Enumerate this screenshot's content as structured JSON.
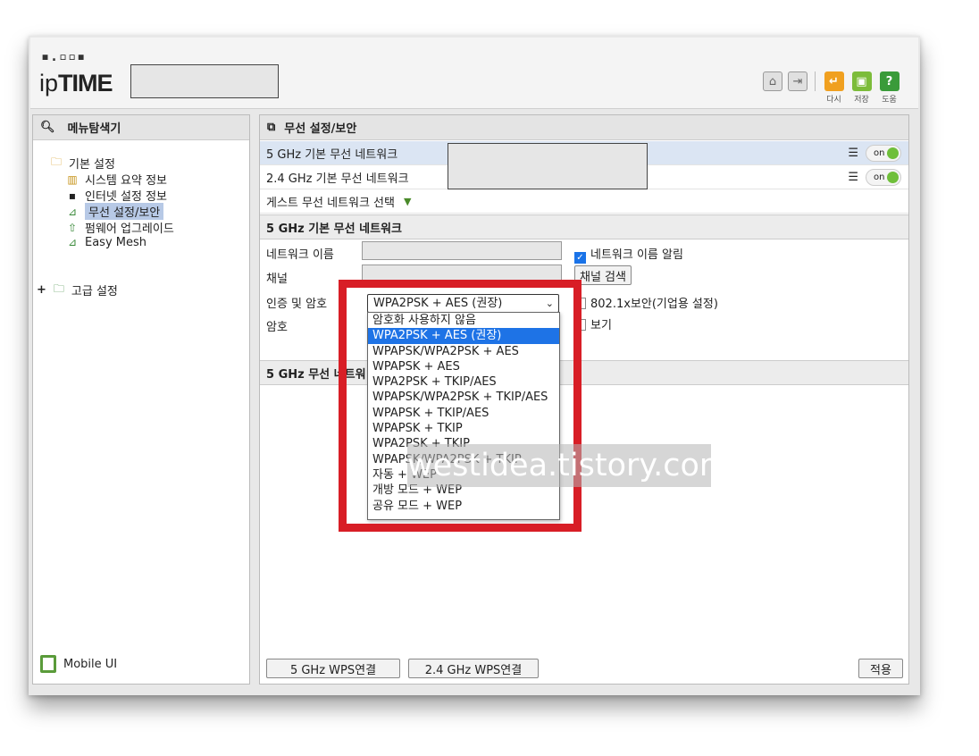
{
  "brand": {
    "logo_dots": "▪.▫▫▪",
    "logo_prefix": "ip",
    "logo_main": "TIME"
  },
  "header_buttons": [
    {
      "icon": "home-icon",
      "label": ""
    },
    {
      "icon": "logout-icon",
      "label": ""
    },
    {
      "icon": "refresh-icon",
      "label": "다시",
      "color": "#f0a020"
    },
    {
      "icon": "save-icon",
      "label": "저장",
      "color": "#7cbc3a"
    },
    {
      "icon": "help-icon",
      "label": "도움",
      "color": "#3a9b3a"
    }
  ],
  "sidebar": {
    "title": "메뉴탐색기",
    "basic": {
      "label": "기본 설정",
      "items": [
        {
          "label": "시스템 요약 정보",
          "icon": "chart-icon"
        },
        {
          "label": "인터넷 설정 정보",
          "icon": "computer-icon"
        },
        {
          "label": "무선 설정/보안",
          "icon": "wireless-icon",
          "selected": true
        },
        {
          "label": "펌웨어 업그레이드",
          "icon": "upgrade-icon"
        },
        {
          "label": "Easy Mesh",
          "icon": "mesh-icon"
        }
      ]
    },
    "advanced": {
      "expand": "+",
      "label": "고급 설정"
    },
    "mobile_label": "Mobile UI"
  },
  "main": {
    "title": "무선 설정/보안",
    "networks": [
      {
        "label": "5 GHz 기본 무선 네트워크",
        "switch": "on"
      },
      {
        "label": "2.4 GHz 기본 무선 네트워크",
        "switch": "on"
      }
    ],
    "guest_label": "게스트 무선 네트워크 선택",
    "section_title": "5 GHz 기본 무선 네트워크",
    "form": {
      "network_name_label": "네트워크 이름",
      "broadcast_label": "네트워크 이름 알림",
      "channel_label": "채널",
      "channel_search_button": "채널 검색",
      "auth_label": "인증 및 암호",
      "auth_selected": "WPA2PSK + AES (권장)",
      "enterprise_label": "802.1x보안(기업용 설정)",
      "password_label": "암호",
      "show_label": "보기"
    },
    "section2_title": "5 GHz 무선 네트워",
    "dropdown_options": [
      "암호화 사용하지 않음",
      "WPA2PSK + AES (권장)",
      "WPAPSK/WPA2PSK + AES",
      "WPAPSK + AES",
      "WPA2PSK + TKIP/AES",
      "WPAPSK/WPA2PSK + TKIP/AES",
      "WPAPSK + TKIP/AES",
      "WPAPSK + TKIP",
      "WPA2PSK + TKIP",
      "WPAPSK/WPA2PSK + TKIP",
      "자동 + WEP",
      "개방 모드 + WEP",
      "공유 모드 + WEP"
    ],
    "dropdown_selected_index": 1,
    "footer": {
      "wps5": "5 GHz WPS연결",
      "wps24": "2.4 GHz WPS연결",
      "apply": "적용"
    }
  },
  "watermark": "westidea.tistory.com",
  "colors": {
    "highlight_red": "#d81e26",
    "selection_blue": "#1e73e6",
    "switch_green": "#6fbf3a"
  }
}
